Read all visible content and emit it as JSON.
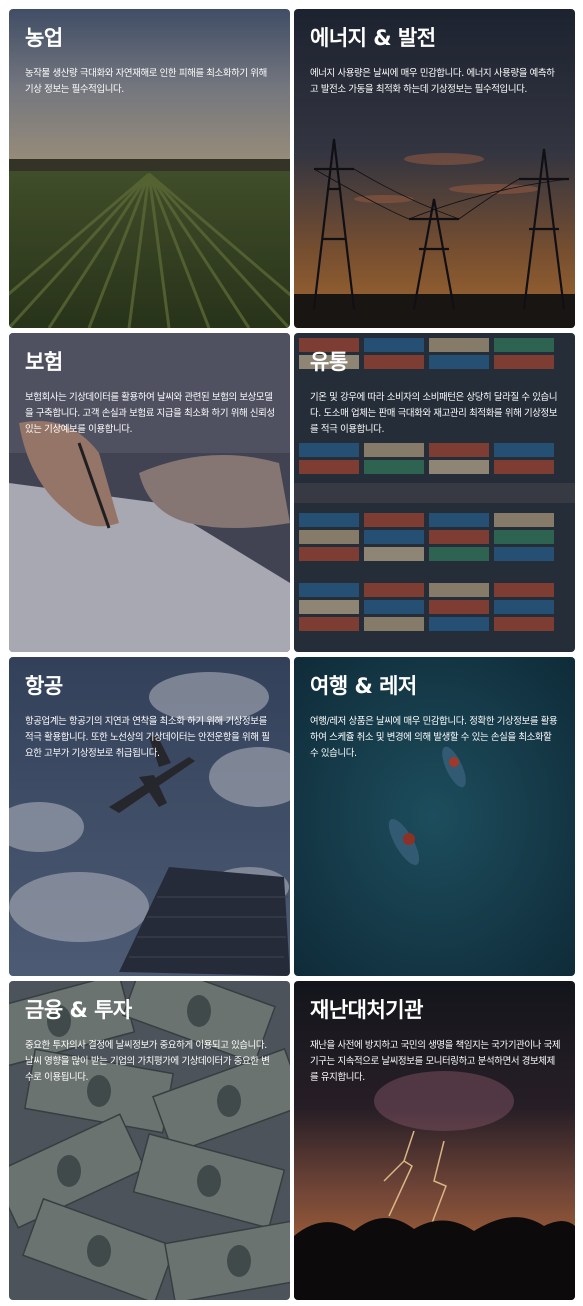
{
  "cards": [
    {
      "title": "농업",
      "desc": "농작물 생산량 극대화와 자연재해로 인한 피해를 최소화하기 위해 기상 정보는 필수적입니다."
    },
    {
      "title": "에너지 & 발전",
      "desc": "에너지 사용량은 날씨에 매우 민감합니다. 에너지 사용량을 예측하고 발전소 가동을 최적화 하는데 기상정보는 필수적입니다."
    },
    {
      "title": "보험",
      "desc": "보험회사는 기상데이터를 활용하여 날씨와 관련된 보험의 보상모델을 구축합니다. 고객 손실과 보험료 지급을 최소화 하기 위해 신뢰성 있는 기상예보를 이용합니다."
    },
    {
      "title": "유통",
      "desc": "기온 및 강우에 따라 소비자의 소비패턴은 상당히 달라질 수 있습니다. 도소매 업체는 판매 극대화와 재고관리 최적화를 위해 기상정보를 적극 이용합니다."
    },
    {
      "title": "항공",
      "desc": "항공업계는 항공기의 지연과 연착을 최소화 하기 위해 기상정보를 적극 활용합니다. 또한 노선상의 기상데이터는 안전운항을 위해 필요한 고부가 기상정보로 취급됩니다."
    },
    {
      "title": "여행 & 레저",
      "desc": "여행/레저 상품은 날씨에 매우 민감합니다. 정확한 기상정보를 활용하여 스케쥴 취소 및 변경에 의해 발생할 수 있는 손실을 최소화할 수 있습니다."
    },
    {
      "title": "금융 & 투자",
      "desc": "중요한 투자의사 결정에 날씨정보가 중요하게 이용되고 있습니다. 날씨 영향을 많이 받는 기업의 가치평가에 기상데이터가 중요한 변수로 이용됩니다."
    },
    {
      "title": "재난대처기관",
      "desc": "재난을 사전에 방지하고 국민의 생명을 책임지는 국가기관이나 국제기구는 지속적으로 날씨정보를 모니터링하고 분석하면서 경보체제를 유지합니다."
    }
  ]
}
